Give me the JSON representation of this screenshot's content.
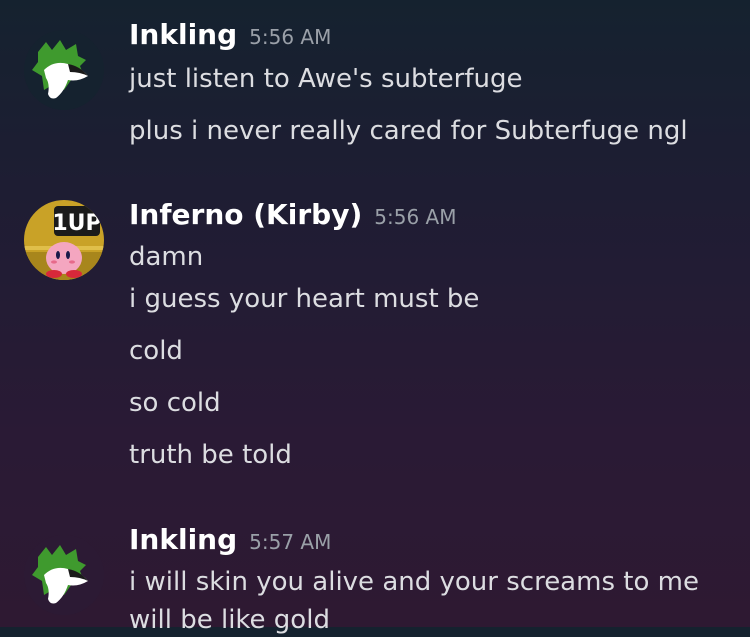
{
  "messages": [
    {
      "author": "Inkling",
      "time": "5:56 AM",
      "avatar_icon": "inkling-avatar-icon",
      "lines": [
        "just listen to Awe's subterfuge",
        "plus i never really cared for Subterfuge ngl"
      ]
    },
    {
      "author": "Inferno (Kirby)",
      "time": "5:56 AM",
      "avatar_icon": "kirby-1up-avatar-icon",
      "avatar_text": "1UP",
      "lines": [
        "damn",
        "i guess your heart must be",
        "cold",
        "so cold",
        "truth be told"
      ]
    },
    {
      "author": "Inkling",
      "time": "5:57 AM",
      "avatar_icon": "inkling-avatar-icon",
      "lines": [
        "i will skin you alive and your screams to me",
        "will be like gold"
      ]
    }
  ],
  "colors": {
    "username": "#ffffff",
    "timestamp": "#9aa0a8",
    "message_text": "#dcdde1",
    "inkling_green": "#3f9a2e",
    "kirby_pink": "#f4a6c0",
    "kirby_background": "#c9a227"
  }
}
